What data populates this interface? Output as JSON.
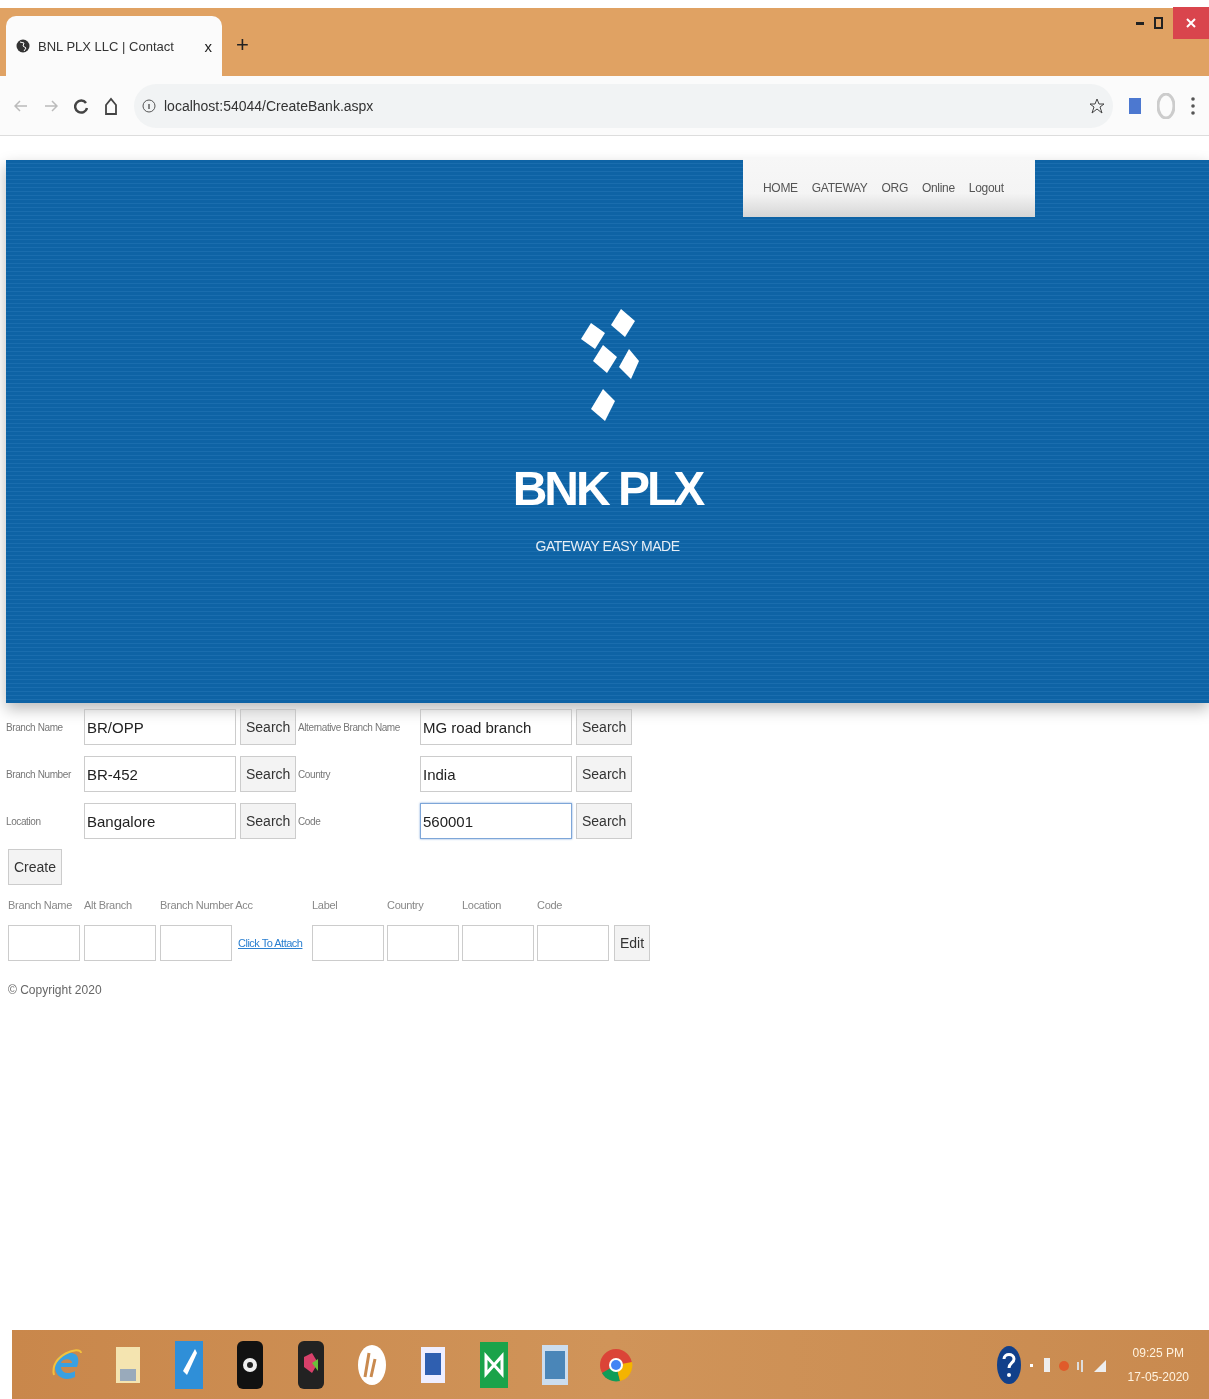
{
  "browser": {
    "tab": {
      "title": "BNL PLX LLC | Contact",
      "close": "x",
      "selected": true
    },
    "new_tab": "+",
    "url": "localhost:54044/CreateBank.aspx"
  },
  "nav": {
    "items": [
      {
        "label": "HOME"
      },
      {
        "label": "GATEWAY"
      },
      {
        "label": "ORG"
      },
      {
        "label": "Online"
      },
      {
        "label": "Logout"
      }
    ]
  },
  "hero": {
    "brand": "BNK PLX",
    "tagline": "GATEWAY EASY MADE"
  },
  "form": {
    "rows": [
      {
        "left": {
          "label": "Branch Name",
          "value": "BR/OPP",
          "button": "Search",
          "focused": false
        },
        "right": {
          "label": "Alternative Branch Name",
          "value": "MG road branch",
          "button": "Search",
          "focused": false
        }
      },
      {
        "left": {
          "label": "Branch Number",
          "value": "BR-452",
          "button": "Search",
          "focused": false
        },
        "right": {
          "label": "Country",
          "value": "India",
          "button": "Search",
          "focused": false
        }
      },
      {
        "left": {
          "label": "Location",
          "value": "Bangalore",
          "button": "Search",
          "focused": false
        },
        "right": {
          "label": "Code",
          "value": "560001",
          "button": "Search",
          "focused": true
        }
      }
    ],
    "create": "Create"
  },
  "grid": {
    "headers": [
      {
        "label": "Branch Name"
      },
      {
        "label": "Alt Branch"
      },
      {
        "label": "Branch Number Acc"
      },
      {
        "label": "Label"
      },
      {
        "label": "Country"
      },
      {
        "label": "Location"
      },
      {
        "label": "Code"
      }
    ],
    "row": [
      {
        "kind": "input"
      },
      {
        "kind": "input"
      },
      {
        "kind": "input"
      },
      {
        "kind": "link",
        "text": "Click To Attach"
      },
      {
        "kind": "input"
      },
      {
        "kind": "input"
      },
      {
        "kind": "input"
      },
      {
        "kind": "input"
      },
      {
        "kind": "button",
        "text": "Edit"
      }
    ]
  },
  "footer": "© Copyright 2020",
  "taskbar": {
    "time": "09:25 PM",
    "date": "17-05-2020"
  }
}
